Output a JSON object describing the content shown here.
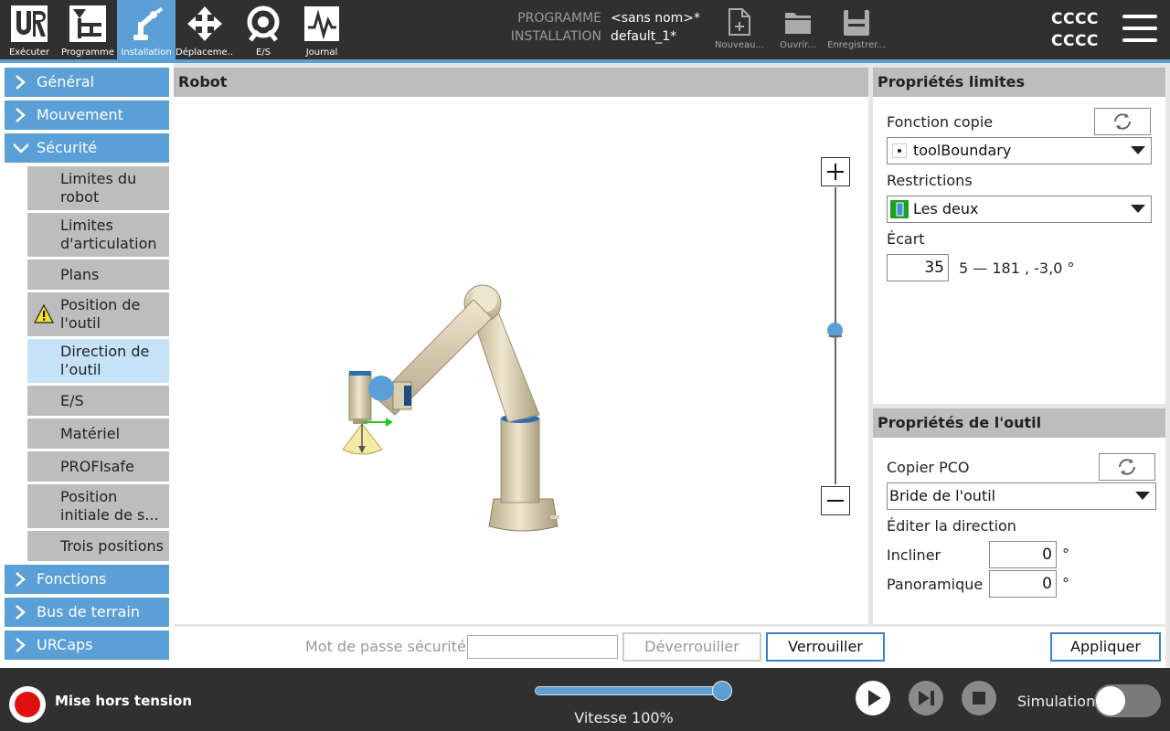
{
  "topbar": {
    "nav": [
      {
        "label": "Exécuter",
        "icon": "ur-logo-icon"
      },
      {
        "label": "Programme",
        "icon": "program-tree-icon"
      },
      {
        "label": "Installation",
        "icon": "robot-arm-icon",
        "active": true
      },
      {
        "label": "Déplaceme...",
        "icon": "move-arrows-icon"
      },
      {
        "label": "E/S",
        "icon": "io-icon"
      },
      {
        "label": "Journal",
        "icon": "log-chart-icon"
      }
    ],
    "program_label": "PROGRAMME",
    "program_value": "<sans nom>*",
    "installation_label": "INSTALLATION",
    "installation_value": "default_1*",
    "file_buttons": [
      {
        "label": "Nouveau...",
        "icon": "new-file-icon"
      },
      {
        "label": "Ouvrir...",
        "icon": "folder-icon"
      },
      {
        "label": "Enregistrer...",
        "icon": "save-icon"
      }
    ],
    "status_line1": "CCCC",
    "status_line2": "CCCC",
    "accent_color": "#5a9fd6"
  },
  "sidebar": {
    "categories": [
      {
        "label": "Général",
        "expanded": false
      },
      {
        "label": "Mouvement",
        "expanded": false
      },
      {
        "label": "Sécurité",
        "expanded": true
      },
      {
        "label": "Fonctions",
        "expanded": false
      },
      {
        "label": "Bus de terrain",
        "expanded": false
      },
      {
        "label": "URCaps",
        "expanded": false
      }
    ],
    "security_items": [
      {
        "label": "Limites du robot"
      },
      {
        "label": "Limites d'articulation"
      },
      {
        "label": "Plans"
      },
      {
        "label": "Position de l'outil",
        "warning": true
      },
      {
        "label": "Direction de l’outil",
        "selected": true
      },
      {
        "label": "E/S"
      },
      {
        "label": "Matériel"
      },
      {
        "label": "PROFIsafe"
      },
      {
        "label": "Position initiale de s..."
      },
      {
        "label": "Trois positions"
      }
    ]
  },
  "robot_view": {
    "title": "Robot",
    "zoom_in": "+",
    "zoom_out": "−"
  },
  "limits": {
    "title": "Propriétés limites",
    "copy_label": "Fonction copie",
    "copy_value": "toolBoundary",
    "restrictions_label": "Restrictions",
    "restrictions_value": "Les deux",
    "ecart_label": "Écart",
    "ecart_value": "35",
    "ecart_info": "5 — 181 , -3,0 °"
  },
  "tool": {
    "title": "Propriétés de l'outil",
    "copy_tcp_label": "Copier PCO",
    "copy_tcp_value": "Bride de l'outil",
    "edit_direction_label": "Éditer la direction",
    "tilt_label": "Incliner",
    "tilt_value": "0",
    "pan_label": "Panoramique",
    "pan_value": "0",
    "unit": "°"
  },
  "actions": {
    "password_label": "Mot de passe sécurité",
    "password_value": "",
    "unlock": "Déverrouiller",
    "lock": "Verrouiller",
    "apply": "Appliquer"
  },
  "footer": {
    "power_label": "Mise hors tension",
    "speed_label": "Vitesse 100%",
    "speed_percent": 100,
    "simulation_label": "Simulation",
    "simulation_on": false
  }
}
